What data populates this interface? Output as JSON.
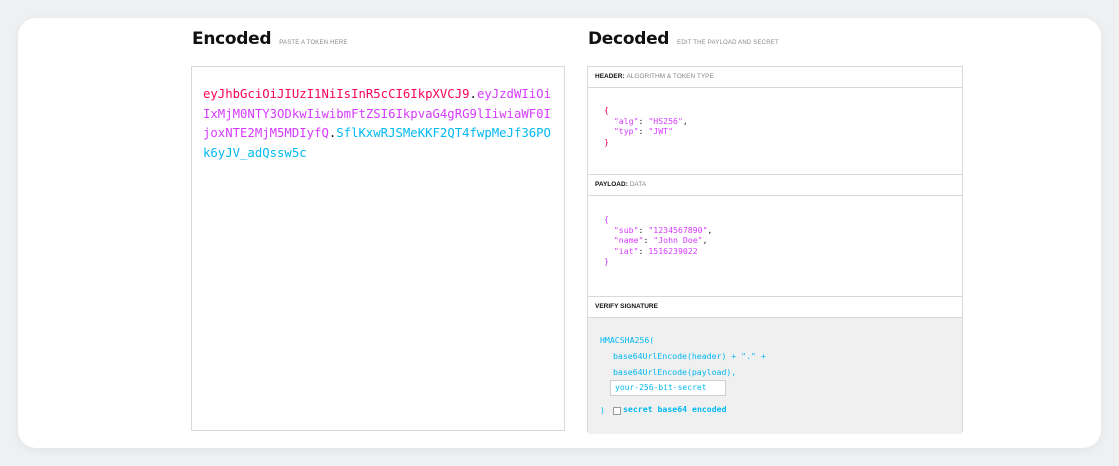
{
  "encoded": {
    "title": "Encoded",
    "subtitle": "PASTE A TOKEN HERE",
    "token_header": "eyJhbGciOiJIUzI1NiIsInR5cCI6IkpXVCJ9",
    "token_payload": "eyJzdWIiOiIxMjM0NTY3ODkwIiwibmFtZSI6IkpvaG4gRG9lIiwiaWF0IjoxNTE2MjM5MDIyfQ",
    "token_signature": "SflKxwRJSMeKKF2QT4fwpMeJf36POk6yJV_adQssw5c",
    "dot": "."
  },
  "decoded": {
    "title": "Decoded",
    "subtitle": "EDIT THE PAYLOAD AND SECRET",
    "header": {
      "label": "HEADER:",
      "label_sub": "ALGORITHM & TOKEN TYPE",
      "lines": {
        "open": "{",
        "alg_key": "\"alg\"",
        "alg_val": "\"HS256\"",
        "typ_key": "\"typ\"",
        "typ_val": "\"JWT\"",
        "close": "}"
      }
    },
    "payload": {
      "label": "PAYLOAD:",
      "label_sub": "DATA",
      "lines": {
        "open": "{",
        "sub_key": "\"sub\"",
        "sub_val": "\"1234567890\"",
        "name_key": "\"name\"",
        "name_val": "\"John Doe\"",
        "iat_key": "\"iat\"",
        "iat_val": "1516239022",
        "close": "}"
      }
    },
    "signature": {
      "label": "VERIFY SIGNATURE",
      "line1": "HMACSHA256(",
      "line2": "base64UrlEncode(header) + \".\" +",
      "line3": "base64UrlEncode(payload),",
      "secret_placeholder": "your-256-bit-secret",
      "close": ")",
      "checkbox_label": "secret base64 encoded"
    }
  },
  "colors": {
    "header": "#fb015b",
    "payload": "#d63aff",
    "signature": "#00b9f1"
  }
}
